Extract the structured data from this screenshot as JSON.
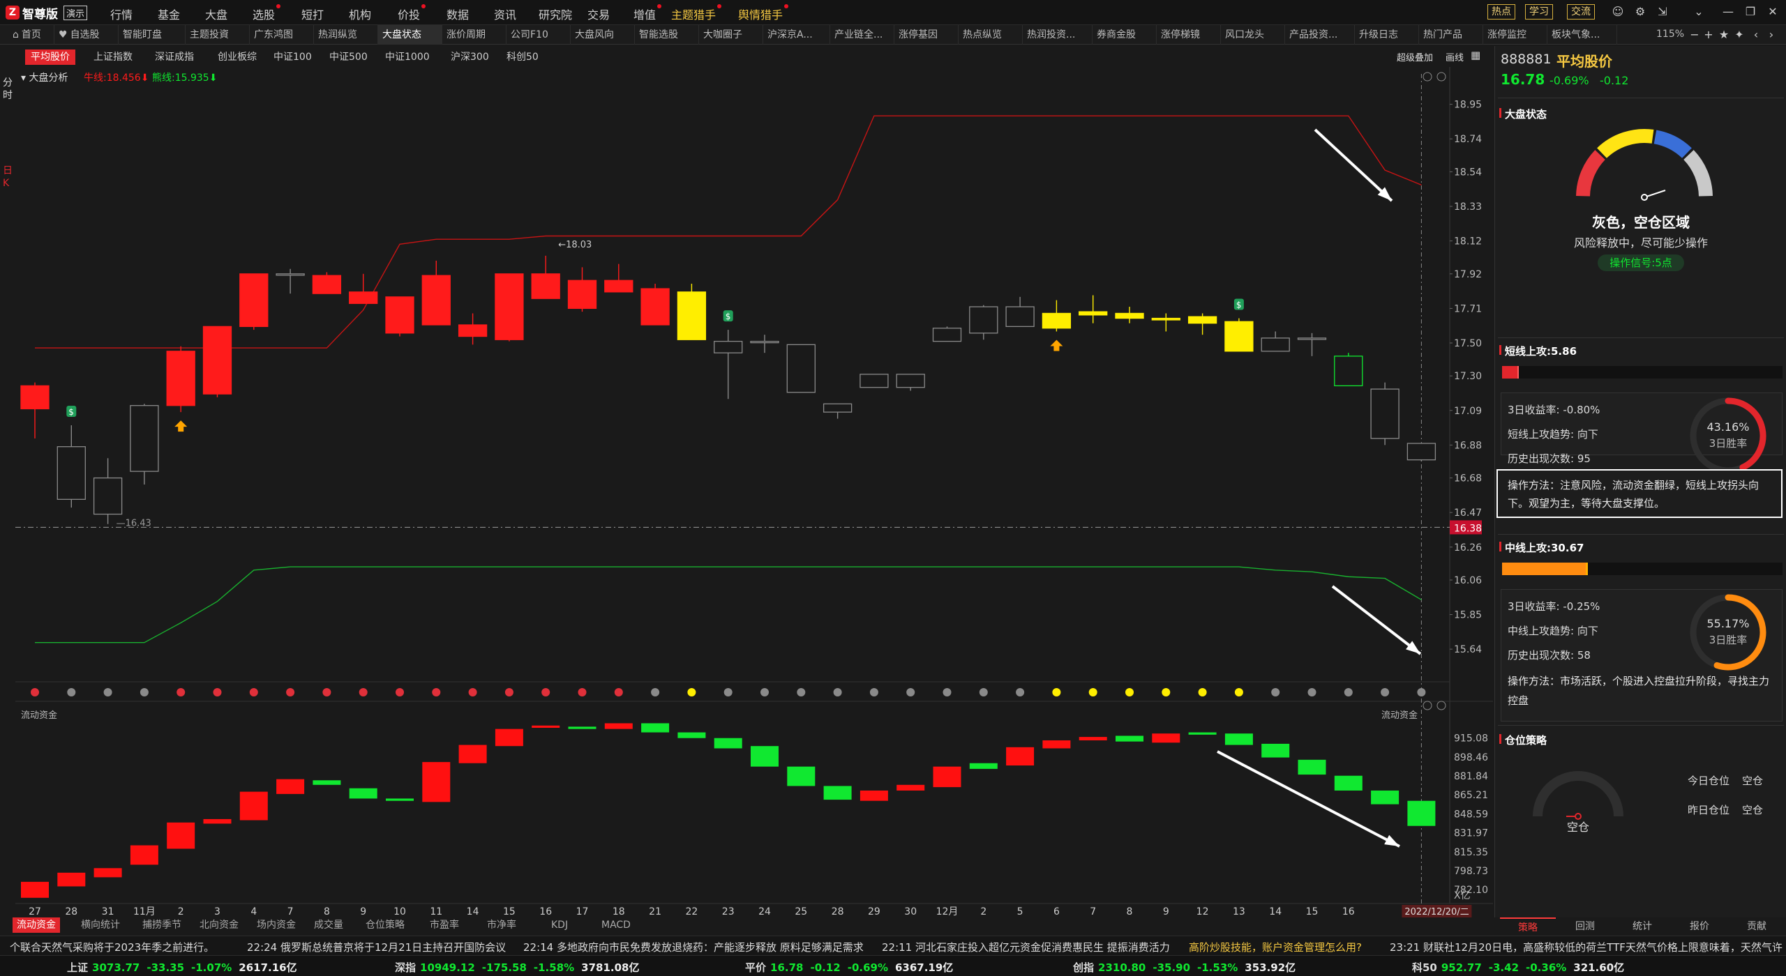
{
  "app": {
    "name": "智尊版",
    "mode": "演示"
  },
  "menu": [
    {
      "label": "行情",
      "dot": false
    },
    {
      "label": "基金",
      "dot": false
    },
    {
      "label": "大盘",
      "dot": false
    },
    {
      "label": "选股",
      "dot": true
    },
    {
      "label": "短打",
      "dot": false
    },
    {
      "label": "机构",
      "dot": false
    },
    {
      "label": "价投",
      "dot": true
    },
    {
      "label": "数据",
      "dot": false
    },
    {
      "label": "资讯",
      "dot": false
    },
    {
      "label": "研究院",
      "dot": false
    },
    {
      "label": "交易",
      "dot": false
    },
    {
      "label": "增值",
      "dot": true
    },
    {
      "label": "主题猎手",
      "dot": true,
      "hl": true
    },
    {
      "label": "舆情猎手",
      "dot": true,
      "hl": true
    }
  ],
  "top_buttons": [
    "热点",
    "学习",
    "交流"
  ],
  "tabs": [
    "首页",
    "自选股",
    "智能盯盘",
    "主题投資",
    "广东鸿图",
    "热润纵览",
    "大盘状态",
    "涨价周期",
    "公司F10",
    "大盘风向",
    "智能选股",
    "大咖圈子",
    "沪深京A...",
    "产业链全...",
    "涨停基因",
    "热点纵览",
    "热润投资...",
    "券商金股",
    "涨停梯镜",
    "风口龙头",
    "产品投资...",
    "升级日志",
    "热门产品",
    "涨停监控",
    "板块气象..."
  ],
  "tab_active": "大盘状态",
  "zoom": "115%",
  "subtabs": [
    "平均股价",
    "上证指数",
    "深证成指",
    "创业板综",
    "中证100",
    "中证500",
    "中证1000",
    "沪深300",
    "科创50"
  ],
  "subtab_active": "平均股价",
  "right_mini": [
    "超级叠加",
    "画线"
  ],
  "left_vertical": [
    "分时",
    "日K"
  ],
  "chart_header": {
    "name": "大盘分析",
    "bull_label": "牛线:18.456",
    "bear_label": "熊线:15.935"
  },
  "chart_data": {
    "type": "candlestick",
    "x_labels": [
      "27",
      "28",
      "31",
      "11月",
      "2",
      "3",
      "4",
      "7",
      "8",
      "9",
      "10",
      "11",
      "14",
      "15",
      "16",
      "17",
      "18",
      "21",
      "22",
      "23",
      "24",
      "25",
      "28",
      "29",
      "30",
      "12月",
      "2",
      "5",
      "6",
      "7",
      "8",
      "9",
      "12",
      "13",
      "14",
      "15",
      "16"
    ],
    "last_date_label": "2022/12/20/二",
    "y_ticks": [
      "18.95",
      "18.74",
      "18.54",
      "18.33",
      "18.12",
      "17.92",
      "17.71",
      "17.50",
      "17.30",
      "17.09",
      "16.88",
      "16.68",
      "16.47",
      "16.26",
      "16.06",
      "15.85",
      "15.64"
    ],
    "ylim": [
      15.45,
      19.05
    ],
    "current_price_label": "16.38",
    "current_price": 16.38,
    "annot_high": "←18.03",
    "annot_low": "16.43",
    "ohlc": [
      [
        17.1,
        17.26,
        16.92,
        17.24,
        "r"
      ],
      [
        16.55,
        17.0,
        16.5,
        16.87,
        "w"
      ],
      [
        16.46,
        16.8,
        16.4,
        16.68,
        "w"
      ],
      [
        16.72,
        17.13,
        16.64,
        17.12,
        "w"
      ],
      [
        17.12,
        17.48,
        17.08,
        17.45,
        "r"
      ],
      [
        17.19,
        17.6,
        17.17,
        17.6,
        "r"
      ],
      [
        17.6,
        17.92,
        17.58,
        17.92,
        "r"
      ],
      [
        17.92,
        17.95,
        17.8,
        17.92,
        "w"
      ],
      [
        17.91,
        17.93,
        17.8,
        17.8,
        "r"
      ],
      [
        17.81,
        17.92,
        17.74,
        17.74,
        "r"
      ],
      [
        17.78,
        17.78,
        17.54,
        17.56,
        "r"
      ],
      [
        17.91,
        18.0,
        17.61,
        17.61,
        "r"
      ],
      [
        17.61,
        17.68,
        17.49,
        17.54,
        "r"
      ],
      [
        17.92,
        17.92,
        17.51,
        17.52,
        "r"
      ],
      [
        17.92,
        18.03,
        17.77,
        17.77,
        "r"
      ],
      [
        17.88,
        17.96,
        17.69,
        17.71,
        "r"
      ],
      [
        17.88,
        17.98,
        17.81,
        17.81,
        "r"
      ],
      [
        17.83,
        17.86,
        17.61,
        17.61,
        "r"
      ],
      [
        17.81,
        17.86,
        17.52,
        17.52,
        "y"
      ],
      [
        17.51,
        17.58,
        17.16,
        17.44,
        "w"
      ],
      [
        17.51,
        17.55,
        17.44,
        17.51,
        "w"
      ],
      [
        17.49,
        17.49,
        17.2,
        17.2,
        "w"
      ],
      [
        17.08,
        17.13,
        17.04,
        17.13,
        "w"
      ],
      [
        17.23,
        17.31,
        17.27,
        17.31,
        "w"
      ],
      [
        17.31,
        17.31,
        17.21,
        17.23,
        "w"
      ],
      [
        17.51,
        17.6,
        17.58,
        17.59,
        "w"
      ],
      [
        17.56,
        17.73,
        17.52,
        17.72,
        "w"
      ],
      [
        17.72,
        17.78,
        17.6,
        17.6,
        "w"
      ],
      [
        17.68,
        17.76,
        17.57,
        17.59,
        "y"
      ],
      [
        17.69,
        17.79,
        17.62,
        17.67,
        "y"
      ],
      [
        17.68,
        17.72,
        17.62,
        17.65,
        "y"
      ],
      [
        17.64,
        17.68,
        17.57,
        17.65,
        "y"
      ],
      [
        17.66,
        17.68,
        17.55,
        17.62,
        "y"
      ],
      [
        17.63,
        17.65,
        17.45,
        17.45,
        "y"
      ],
      [
        17.45,
        17.57,
        17.46,
        17.53,
        "w"
      ],
      [
        17.53,
        17.56,
        17.42,
        17.53,
        "w"
      ],
      [
        17.42,
        17.44,
        17.24,
        17.24,
        "g"
      ],
      [
        17.22,
        17.26,
        16.88,
        16.92,
        "w"
      ],
      [
        16.79,
        16.89,
        16.78,
        16.89,
        "w"
      ]
    ],
    "bull_line": [
      17.47,
      17.47,
      17.47,
      17.47,
      17.47,
      17.47,
      17.47,
      17.47,
      17.47,
      17.7,
      18.1,
      18.13,
      18.13,
      18.13,
      18.15,
      18.15,
      18.15,
      18.15,
      18.15,
      18.15,
      18.15,
      18.15,
      18.37,
      18.88,
      18.88,
      18.88,
      18.88,
      18.88,
      18.88,
      18.88,
      18.88,
      18.88,
      18.88,
      18.88,
      18.88,
      18.88,
      18.88,
      18.55,
      18.46
    ],
    "bear_line": [
      15.68,
      15.68,
      15.68,
      15.68,
      15.8,
      15.93,
      16.12,
      16.14,
      16.14,
      16.14,
      16.14,
      16.14,
      16.14,
      16.14,
      16.14,
      16.14,
      16.14,
      16.14,
      16.14,
      16.14,
      16.14,
      16.14,
      16.14,
      16.14,
      16.14,
      16.14,
      16.14,
      16.14,
      16.14,
      16.14,
      16.14,
      16.14,
      16.14,
      16.14,
      16.12,
      16.11,
      16.08,
      16.07,
      15.94
    ],
    "signals": [
      {
        "type": "sell",
        "index": 1
      },
      {
        "type": "buy",
        "index": 4
      },
      {
        "type": "sell",
        "index": 19
      },
      {
        "type": "buy",
        "index": 28
      },
      {
        "type": "sell",
        "index": 33
      }
    ],
    "dots": [
      "r",
      "g",
      "g",
      "g",
      "r",
      "r",
      "r",
      "r",
      "r",
      "r",
      "r",
      "r",
      "r",
      "r",
      "r",
      "r",
      "r",
      "g",
      "y",
      "g",
      "g",
      "g",
      "g",
      "g",
      "g",
      "g",
      "g",
      "g",
      "y",
      "y",
      "y",
      "y",
      "y",
      "y",
      "g",
      "g",
      "g",
      "g",
      "g"
    ],
    "flow": {
      "title": "流动资金",
      "y_ticks": [
        "915.08",
        "898.46",
        "881.84",
        "865.21",
        "848.59",
        "831.97",
        "815.35",
        "798.73",
        "782.10"
      ],
      "ylim": [
        770,
        935
      ],
      "unit": "亿",
      "bars": [
        [
          775,
          789,
          "r"
        ],
        [
          785,
          797,
          "r"
        ],
        [
          793,
          801,
          "r"
        ],
        [
          804,
          821,
          "r"
        ],
        [
          818,
          841,
          "r"
        ],
        [
          840,
          844,
          "r"
        ],
        [
          843,
          868,
          "r"
        ],
        [
          866,
          879,
          "r"
        ],
        [
          874,
          878,
          "g"
        ],
        [
          862,
          871,
          "g"
        ],
        [
          860,
          862,
          "g"
        ],
        [
          859,
          894,
          "r"
        ],
        [
          893,
          909,
          "r"
        ],
        [
          908,
          923,
          "r"
        ],
        [
          924,
          926,
          "r"
        ],
        [
          925,
          923,
          "g"
        ],
        [
          923,
          928,
          "r"
        ],
        [
          928,
          920,
          "g"
        ],
        [
          920,
          915,
          "g"
        ],
        [
          915,
          906,
          "g"
        ],
        [
          908,
          890,
          "g"
        ],
        [
          890,
          873,
          "g"
        ],
        [
          873,
          861,
          "g"
        ],
        [
          860,
          869,
          "r"
        ],
        [
          869,
          874,
          "r"
        ],
        [
          872,
          890,
          "r"
        ],
        [
          888,
          893,
          "g"
        ],
        [
          891,
          907,
          "r"
        ],
        [
          906,
          913,
          "r"
        ],
        [
          913,
          916,
          "r"
        ],
        [
          917,
          912,
          "g"
        ],
        [
          911,
          919,
          "r"
        ],
        [
          918,
          920,
          "g"
        ],
        [
          919,
          909,
          "g"
        ],
        [
          910,
          898,
          "g"
        ],
        [
          896,
          883,
          "g"
        ],
        [
          882,
          869,
          "g"
        ],
        [
          869,
          857,
          "g"
        ],
        [
          860,
          838,
          "g"
        ]
      ]
    }
  },
  "right_panel": {
    "code": "888881",
    "name": "平均股价",
    "price": "16.78",
    "change_pct": "-0.69%",
    "change": "-0.12",
    "market_state": {
      "title": "大盘状态",
      "status": "灰色，空仓区域",
      "desc": "风险释放中，尽可能少操作",
      "signal": "操作信号:5点"
    },
    "short": {
      "title": "短线上攻:5.86",
      "progress": 0.0586,
      "ret3": "3日收益率: -0.80%",
      "trend": "短线上攻趋势: 向下",
      "count": "历史出现次数: 95",
      "winrate_pct": "43.16%",
      "winrate": 0.4316,
      "winrate_label": "3日胜率",
      "method": "操作方法：注意风险，流动资金翻绿，短线上攻拐头向下。观望为主，等待大盘支撑位。"
    },
    "mid": {
      "title": "中线上攻:30.67",
      "progress": 0.3067,
      "ret3": "3日收益率: -0.25%",
      "trend": "中线上攻趋势: 向下",
      "count": "历史出现次数: 58",
      "winrate_pct": "55.17%",
      "winrate": 0.5517,
      "winrate_label": "3日胜率",
      "method": "操作方法：市场活跃，个股进入控盘拉升阶段，寻找主力控盘"
    },
    "position": {
      "title": "仓位策略",
      "gauge_label": "空仓",
      "today_label": "今日仓位",
      "today_value": "空仓",
      "yesterday_label": "昨日仓位",
      "yesterday_value": "空仓"
    }
  },
  "bottom_tabs": [
    "流动资金",
    "横向统计",
    "捕捞季节",
    "北向资金",
    "场内资金",
    "成交量",
    "仓位策略",
    "市盈率",
    "市净率",
    "KDJ",
    "MACD"
  ],
  "bottom_tab_active": "流动资金",
  "right_tabs": [
    "策略",
    "回测",
    "统计",
    "报价",
    "贡献"
  ],
  "right_tab_active": "策略",
  "news": [
    "个联合天然气采购将于2023年季之前进行。",
    "22:24 俄罗斯总统普京将于12月21日主持召开国防会议",
    "22:14 多地政府向市民免费发放退烧药：产能逐步释放 原料足够满足需求",
    "22:11 河北石家庄投入超亿元资金促消费惠民生 提振消费活力",
    "高阶炒股技能，账户资金管理怎么用?",
    "23:21 财联社12月20日电，高盛称较低的荷兰TTF天然气价格上限意味着，天然气许"
  ],
  "indices": [
    {
      "name": "上证",
      "value": "3073.77",
      "chg": "-33.35",
      "pct": "-1.07%",
      "amt": "2617.16亿"
    },
    {
      "name": "深指",
      "value": "10949.12",
      "chg": "-175.58",
      "pct": "-1.58%",
      "amt": "3781.08亿"
    },
    {
      "name": "平价",
      "value": "16.78",
      "chg": "-0.12",
      "pct": "-0.69%",
      "amt": "6367.19亿"
    },
    {
      "name": "创指",
      "value": "2310.80",
      "chg": "-35.90",
      "pct": "-1.53%",
      "amt": "353.92亿"
    },
    {
      "name": "科50",
      "value": "952.77",
      "chg": "-3.42",
      "pct": "-0.36%",
      "amt": "321.60亿"
    }
  ],
  "colors": {
    "red": "#ff1b1b",
    "green": "#10e830",
    "yellow": "#ffee00",
    "accent": "#e3262c"
  }
}
